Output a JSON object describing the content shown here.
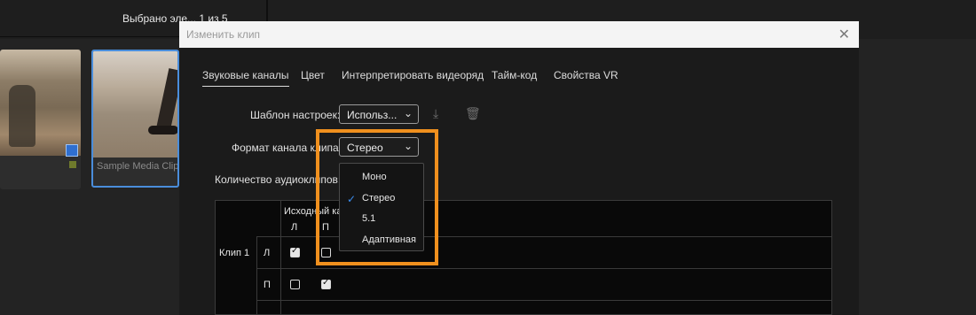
{
  "background": {
    "selected_text": "Выбрано эле...  1 из 5",
    "thumbnail_label": "Sample Media Clip"
  },
  "dialog": {
    "title": "Изменить клип",
    "tabs": [
      "Звуковые каналы",
      "Цвет",
      "Интерпретировать видеоряд",
      "Тайм-код",
      "Свойства VR"
    ],
    "active_tab": "Звуковые каналы",
    "preset_label": "Шаблон настроек:",
    "preset_value": "Использ...",
    "channel_format_label": "Формат канала клипа:",
    "channel_format_value": "Стерео",
    "audio_clips_label": "Количество аудиоклипов:",
    "table": {
      "source_header": "Исходный ка",
      "col_left": "Л",
      "col_right": "П",
      "clip_label": "Клип 1",
      "row_left": "Л",
      "row_right": "П",
      "checks": [
        [
          true,
          false
        ],
        [
          false,
          true
        ]
      ]
    },
    "dropdown": {
      "options": [
        "Моно",
        "Стерео",
        "5.1",
        "Адаптивная"
      ],
      "selected": "Стерео"
    }
  },
  "colors": {
    "highlight": "#f0901e",
    "check_accent": "#3c8ef0",
    "selection_border": "#4a8ddb"
  }
}
